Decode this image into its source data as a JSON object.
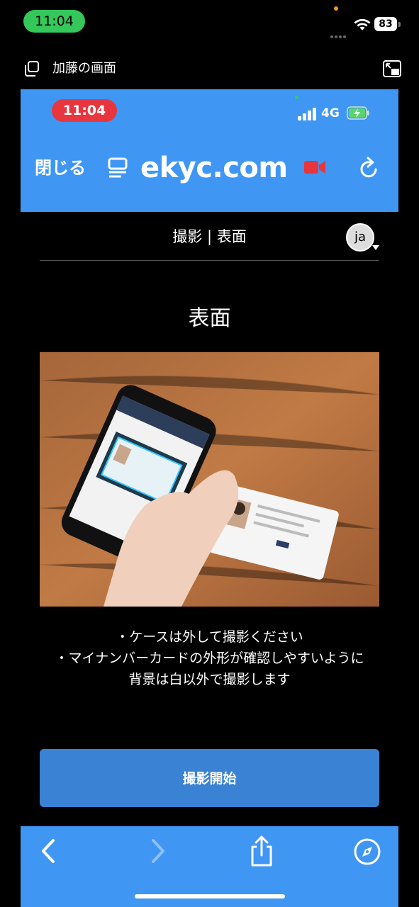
{
  "status_bar": {
    "time": "11:04",
    "battery": "83"
  },
  "share_bar": {
    "title": "加藤の画面"
  },
  "inner_status": {
    "time": "11:04",
    "network": "4G"
  },
  "browser_header": {
    "close_label": "閉じる",
    "domain": "ekyc.com"
  },
  "page": {
    "step_title": "撮影 | 表面",
    "language": "ja",
    "side_title": "表面",
    "instructions": [
      "・ケースは外して撮影ください",
      "・マイナンバーカードの外形が確認しやすいように",
      "背景は白以外で撮影します"
    ],
    "start_button": "撮影開始"
  },
  "colors": {
    "header_blue": "#3f96f3",
    "button_blue": "#3a82d4",
    "status_green": "#34c759",
    "record_red": "#e8363e"
  },
  "icons": {
    "share_screen": "screen-share-icon",
    "pip": "pip-icon",
    "reader": "reader-icon",
    "record": "video-record-icon",
    "reload": "reload-icon",
    "back": "chevron-left-icon",
    "forward": "chevron-right-icon",
    "share": "share-icon",
    "compass": "compass-icon"
  }
}
